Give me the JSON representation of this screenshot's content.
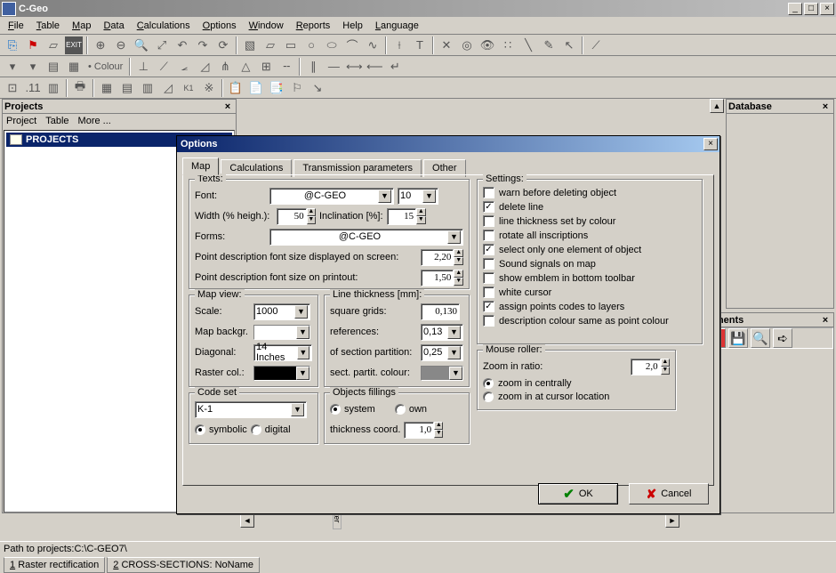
{
  "app": {
    "title": "C-Geo"
  },
  "mainmenu": [
    "File",
    "Table",
    "Map",
    "Data",
    "Calculations",
    "Options",
    "Window",
    "Reports",
    "Help",
    "Language"
  ],
  "panels": {
    "projects": {
      "title": "Projects",
      "toolbar": [
        "Project",
        "Table",
        "More ..."
      ],
      "root": "PROJECTS"
    },
    "database": {
      "title": "Database"
    },
    "documents": {
      "title": "cuments"
    }
  },
  "statusbar": "Path to projects:C:\\C-GEO7\\",
  "bottomTabs": [
    "1 Raster rectification",
    "2 CROSS-SECTIONS: NoName"
  ],
  "dialog": {
    "title": "Options",
    "tabs": [
      "Map",
      "Calculations",
      "Transmission parameters",
      "Other"
    ],
    "activeTab": 0,
    "texts": {
      "legend": "Texts:",
      "fontLabel": "Font:",
      "font": "@C-GEO",
      "fontSize": "10",
      "widthLabel": "Width  (% heigh.):",
      "width": "50",
      "inclinationLabel": "Inclination [%]:",
      "inclination": "15",
      "formsLabel": "Forms:",
      "forms": "@C-GEO",
      "pdScreen": "Point description font size displayed on screen:",
      "pdScreenVal": "2,20",
      "pdPrint": "Point description font size  on printout:",
      "pdPrintVal": "1,50"
    },
    "mapview": {
      "legend": "Map view:",
      "scaleLabel": "Scale:",
      "scale": "1000",
      "backgrLabel": "Map backgr.",
      "backgr": "",
      "diagLabel": "Diagonal:",
      "diag": "14 Inches",
      "rasterLabel": "Raster col.:"
    },
    "lineThickness": {
      "legend": "Line thickness [mm]:",
      "sqLabel": "square grids:",
      "sq": "0,130",
      "refLabel": "references:",
      "ref": "0,13",
      "sectLabel": "of section partition:",
      "sect": "0,25",
      "colLabel": "sect. partit. colour:"
    },
    "codeset": {
      "legend": "Code set",
      "value": "K-1",
      "symbolic": "symbolic",
      "digital": "digital"
    },
    "objfill": {
      "legend": "Objects fillings",
      "system": "system",
      "own": "own",
      "thickLabel": "thickness coord.",
      "thick": "1,0"
    },
    "settings": {
      "legend": "Settings:",
      "items": [
        {
          "label": "warn before deleting object",
          "checked": false
        },
        {
          "label": "delete line",
          "checked": true
        },
        {
          "label": "line thickness set by colour",
          "checked": false
        },
        {
          "label": "rotate all inscriptions",
          "checked": false
        },
        {
          "label": "select only one element of object",
          "checked": true
        },
        {
          "label": "Sound signals on map",
          "checked": false
        },
        {
          "label": "show emblem in bottom toolbar",
          "checked": false
        },
        {
          "label": "white cursor",
          "checked": false
        },
        {
          "label": "assign points codes to layers",
          "checked": true
        },
        {
          "label": "description colour same as point colour",
          "checked": false
        }
      ]
    },
    "mouse": {
      "legend": "Mouse roller:",
      "zoomLabel": "Zoom in ratio:",
      "zoom": "2,0",
      "optCentral": "zoom in centrally",
      "optCursor": "zoom in at cursor location"
    },
    "okLabel": "OK",
    "cancelLabel": "Cancel"
  }
}
